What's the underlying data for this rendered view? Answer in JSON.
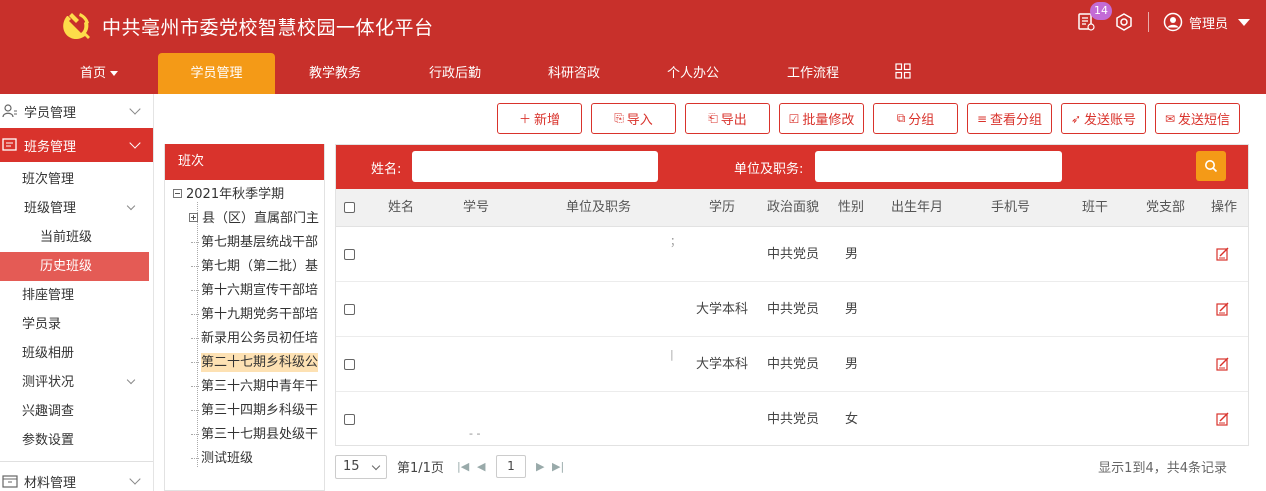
{
  "header": {
    "title": "中共亳州市委党校智慧校园一体化平台",
    "notification_count": "14",
    "user_name": "管理员",
    "brand_color": "#c8302b",
    "accent_color": "#f49a17"
  },
  "nav": {
    "items": [
      {
        "label": "首页",
        "has_caret": true
      },
      {
        "label": "学员管理",
        "active": true
      },
      {
        "label": "教学教务"
      },
      {
        "label": "行政后勤"
      },
      {
        "label": "科研咨政"
      },
      {
        "label": "个人办公"
      },
      {
        "label": "工作流程"
      }
    ],
    "grid_icon": "grid-icon"
  },
  "sidebar": {
    "groups": [
      {
        "label": "学员管理",
        "icon": "student-icon"
      },
      {
        "label": "班务管理",
        "icon": "class-icon",
        "active": true
      },
      {
        "label": "材料管理",
        "icon": "materials-icon"
      }
    ],
    "items": [
      {
        "label": "班次管理"
      },
      {
        "label": "班级管理",
        "expandable": true
      },
      {
        "label": "当前班级"
      },
      {
        "label": "历史班级",
        "active": true
      },
      {
        "label": "排座管理"
      },
      {
        "label": "学员录"
      },
      {
        "label": "班级相册"
      },
      {
        "label": "测评状况",
        "expandable": true
      },
      {
        "label": "兴趣调查"
      },
      {
        "label": "参数设置"
      }
    ]
  },
  "toolbar": {
    "buttons": [
      {
        "label": "新增",
        "icon": "plus-icon",
        "glyph": "＋"
      },
      {
        "label": "导入",
        "icon": "import-icon",
        "glyph": "⎘"
      },
      {
        "label": "导出",
        "icon": "export-icon",
        "glyph": "⎗"
      },
      {
        "label": "批量修改",
        "icon": "batch-edit-icon",
        "glyph": "☑"
      },
      {
        "label": "分组",
        "icon": "group-icon",
        "glyph": "⧉"
      },
      {
        "label": "查看分组",
        "icon": "list-icon",
        "glyph": "≡"
      },
      {
        "label": "发送账号",
        "icon": "send-icon",
        "glyph": "➶"
      },
      {
        "label": "发送短信",
        "icon": "sms-icon",
        "glyph": "✉"
      }
    ]
  },
  "tree": {
    "header": "班次",
    "root": "2021年秋季学期",
    "nodes": [
      {
        "label": "县（区）直属部门主",
        "expandable": true
      },
      {
        "label": "第七期基层统战干部"
      },
      {
        "label": "第七期（第二批）基"
      },
      {
        "label": "第十六期宣传干部培"
      },
      {
        "label": "第十九期党务干部培"
      },
      {
        "label": "新录用公务员初任培"
      },
      {
        "label": "第二十七期乡科级公",
        "selected": true
      },
      {
        "label": "第三十六期中青年干"
      },
      {
        "label": "第三十四期乡科级干"
      },
      {
        "label": "第三十七期县处级干"
      },
      {
        "label": "测试班级"
      }
    ]
  },
  "search": {
    "name_label": "姓名:",
    "name_value": "",
    "unit_label": "单位及职务:",
    "unit_value": "",
    "search_icon": "search-icon"
  },
  "table": {
    "columns": [
      "姓名",
      "学号",
      "单位及职务",
      "学历",
      "政治面貌",
      "性别",
      "出生年月",
      "手机号",
      "班干",
      "党支部",
      "操作"
    ],
    "rows": [
      {
        "name": "",
        "student_no": "",
        "unit": "",
        "education": "",
        "political": "中共党员",
        "gender": "男",
        "birth": "",
        "phone": "",
        "cadre": "",
        "branch": "",
        "mark": "；"
      },
      {
        "name": "",
        "student_no": "",
        "unit": "",
        "education": "大学本科",
        "political": "中共党员",
        "gender": "男",
        "birth": "",
        "phone": "",
        "cadre": "",
        "branch": "",
        "mark": ""
      },
      {
        "name": "",
        "student_no": "",
        "unit": "",
        "education": "大学本科",
        "political": "中共党员",
        "gender": "男",
        "birth": "",
        "phone": "",
        "cadre": "",
        "branch": "",
        "mark": "|"
      },
      {
        "name": "",
        "student_no": "",
        "unit": "",
        "education": "",
        "political": "中共党员",
        "gender": "女",
        "birth": "",
        "phone": "",
        "cadre": "",
        "branch": "",
        "mark": "- -"
      }
    ]
  },
  "pager": {
    "page_size": "15",
    "page_info": "第1/1页",
    "current_page": "1",
    "summary": "显示1到4，共4条记录"
  }
}
